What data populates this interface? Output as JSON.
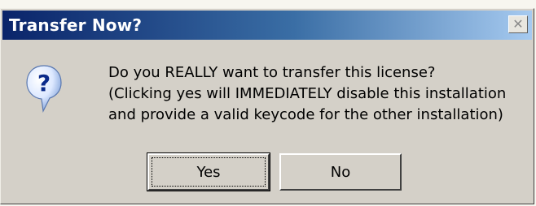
{
  "dialog": {
    "title": "Transfer Now?",
    "close_label": "✕",
    "icon": "question-icon",
    "message_lines": [
      "Do you REALLY want to transfer this license?",
      "(Clicking yes will IMMEDIATELY disable this installation",
      "and provide a valid keycode for the other installation)"
    ],
    "buttons": {
      "yes": "Yes",
      "no": "No"
    }
  },
  "colors": {
    "title_gradient_start": "#0a246a",
    "title_gradient_end": "#a6caf0",
    "dialog_face": "#d4d0c8"
  }
}
